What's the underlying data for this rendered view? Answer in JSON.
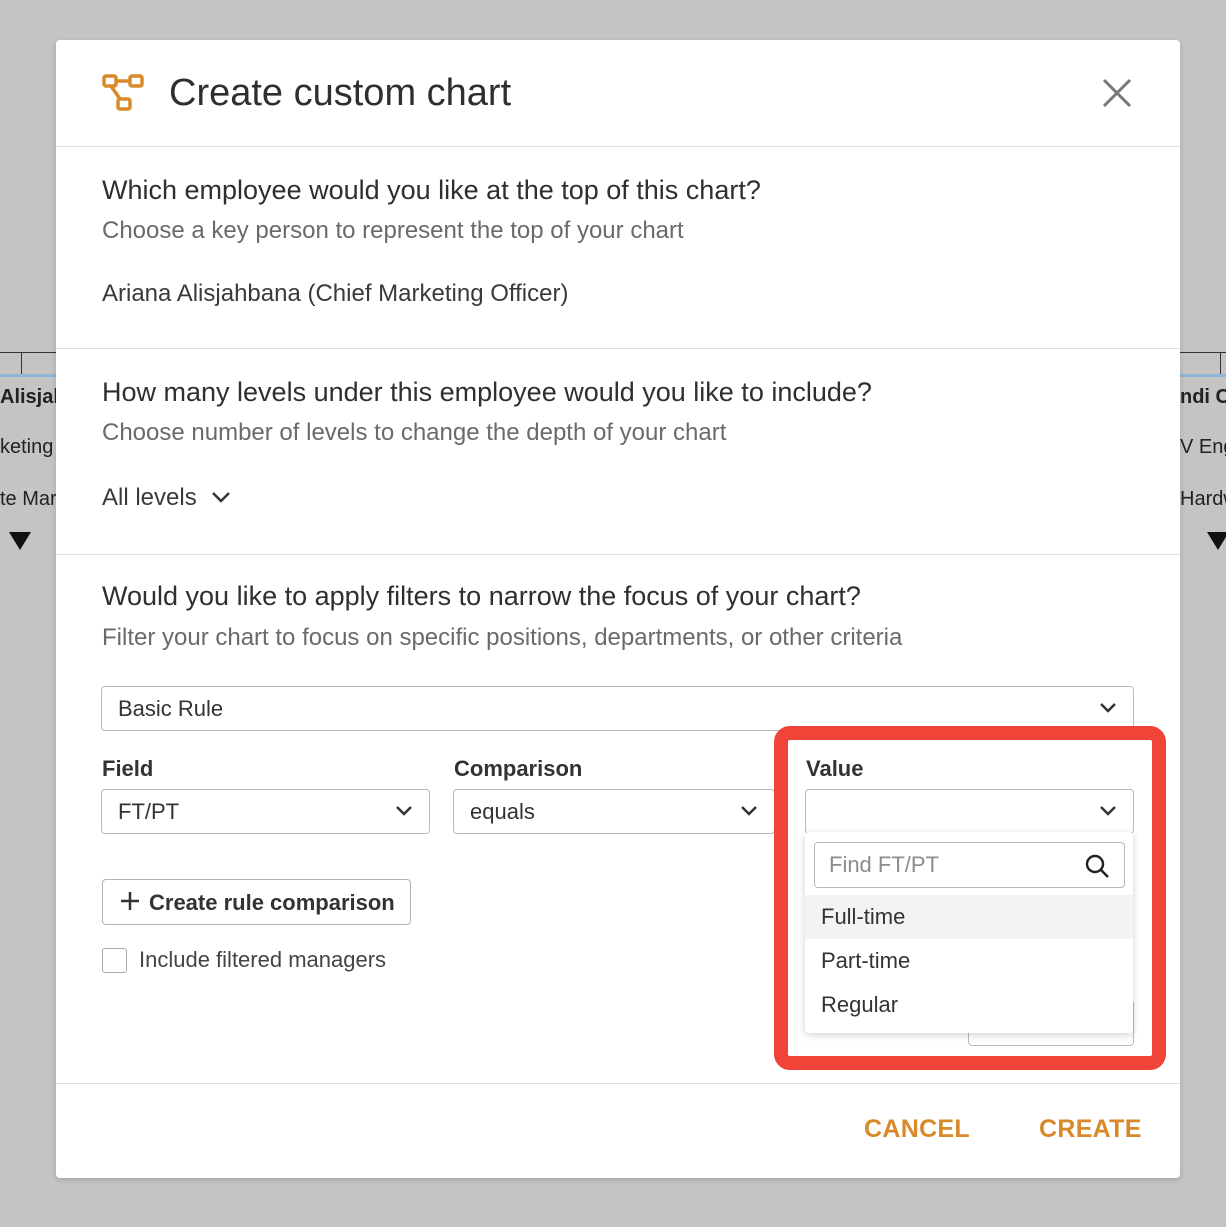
{
  "background": {
    "left_card": {
      "name": "Alisjal",
      "line2": "keting",
      "line3": "te Mar"
    },
    "right_card": {
      "name": "ndi C",
      "line2": "V Eng",
      "line3": "Hardw"
    }
  },
  "modal": {
    "title": "Create custom chart",
    "icon": "org-chart-icon",
    "accent_color": "#d88a2a"
  },
  "section_top": {
    "question": "Which employee would you like at the top of this chart?",
    "subtitle": "Choose a key person to represent the top of your chart",
    "value": "Ariana Alisjahbana (Chief Marketing Officer)"
  },
  "section_levels": {
    "question": "How many levels under this employee would you like to include?",
    "subtitle": "Choose number of levels to change the depth of your chart",
    "value": "All levels"
  },
  "section_filters": {
    "question": "Would you like to apply filters to narrow the focus of your chart?",
    "subtitle": "Filter your chart to focus on specific positions, departments, or other criteria",
    "rule_type": "Basic Rule",
    "field_label": "Field",
    "field_value": "FT/PT",
    "comparison_label": "Comparison",
    "comparison_value": "equals",
    "value_label": "Value",
    "value_value": "",
    "create_rule_label": "Create rule comparison",
    "include_managers_label": "Include filtered managers",
    "include_managers_checked": false
  },
  "dropdown": {
    "search_placeholder": "Find FT/PT",
    "options": [
      "Full-time",
      "Part-time",
      "Regular"
    ]
  },
  "footer": {
    "cancel_label": "CANCEL",
    "create_label": "CREATE"
  },
  "highlight_color": "#f04438"
}
